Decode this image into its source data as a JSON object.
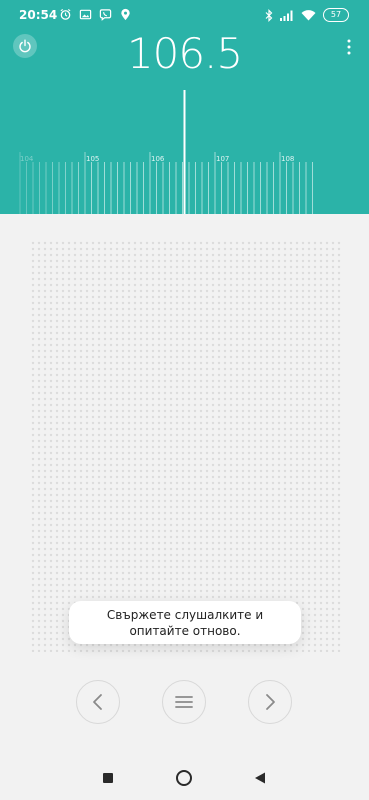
{
  "status_bar": {
    "time": "20:54",
    "battery": "57",
    "icons": [
      "alarm-icon",
      "gallery-icon",
      "viber-icon",
      "location-icon",
      "bluetooth-icon",
      "signal-icon",
      "wifi-icon",
      "battery-icon"
    ]
  },
  "radio": {
    "frequency": "106.5",
    "dial_labels": [
      "104",
      "105",
      "106",
      "107",
      "108"
    ]
  },
  "toast": {
    "message": "Свържете слушалките и\nопитайте отново."
  },
  "controls": {
    "prev_icon": "chevron-left-icon",
    "list_icon": "menu-lines-icon",
    "next_icon": "chevron-right-icon"
  },
  "navigation": {
    "icons": [
      "recent-apps-icon",
      "home-icon",
      "back-icon"
    ]
  },
  "colors": {
    "header_teal": "#2bb3a8",
    "background": "#f2f2f2",
    "dot_gray": "#dcdcdc"
  }
}
